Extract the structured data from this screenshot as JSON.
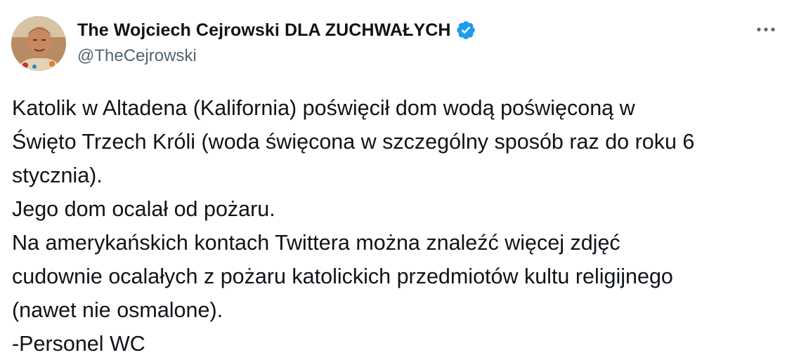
{
  "author": {
    "display_name": "The Wojciech Cejrowski DLA ZUCHWAŁYCH",
    "handle": "@TheCejrowski",
    "verified": true,
    "avatar_icon": "user-photo-avatar"
  },
  "tweet": {
    "text": "Katolik w Altadena (Kalifornia) poświęcił dom wodą poświęconą w\nŚwięto Trzech Króli (woda święcona w szczególny sposób raz do roku 6\nstycznia).\nJego dom ocalał od pożaru.\nNa amerykańskich kontach Twittera można znaleźć więcej zdjęć\ncudownie ocalałych z pożaru katolickich przedmiotów kultu religijnego\n(nawet nie osmalone).\n-Personel WC"
  },
  "icons": {
    "verified": "verified-badge-icon",
    "more": "more-options-icon"
  },
  "colors": {
    "text": "#0f1419",
    "secondary": "#536471",
    "verified": "#1d9bf0",
    "background": "#ffffff"
  }
}
